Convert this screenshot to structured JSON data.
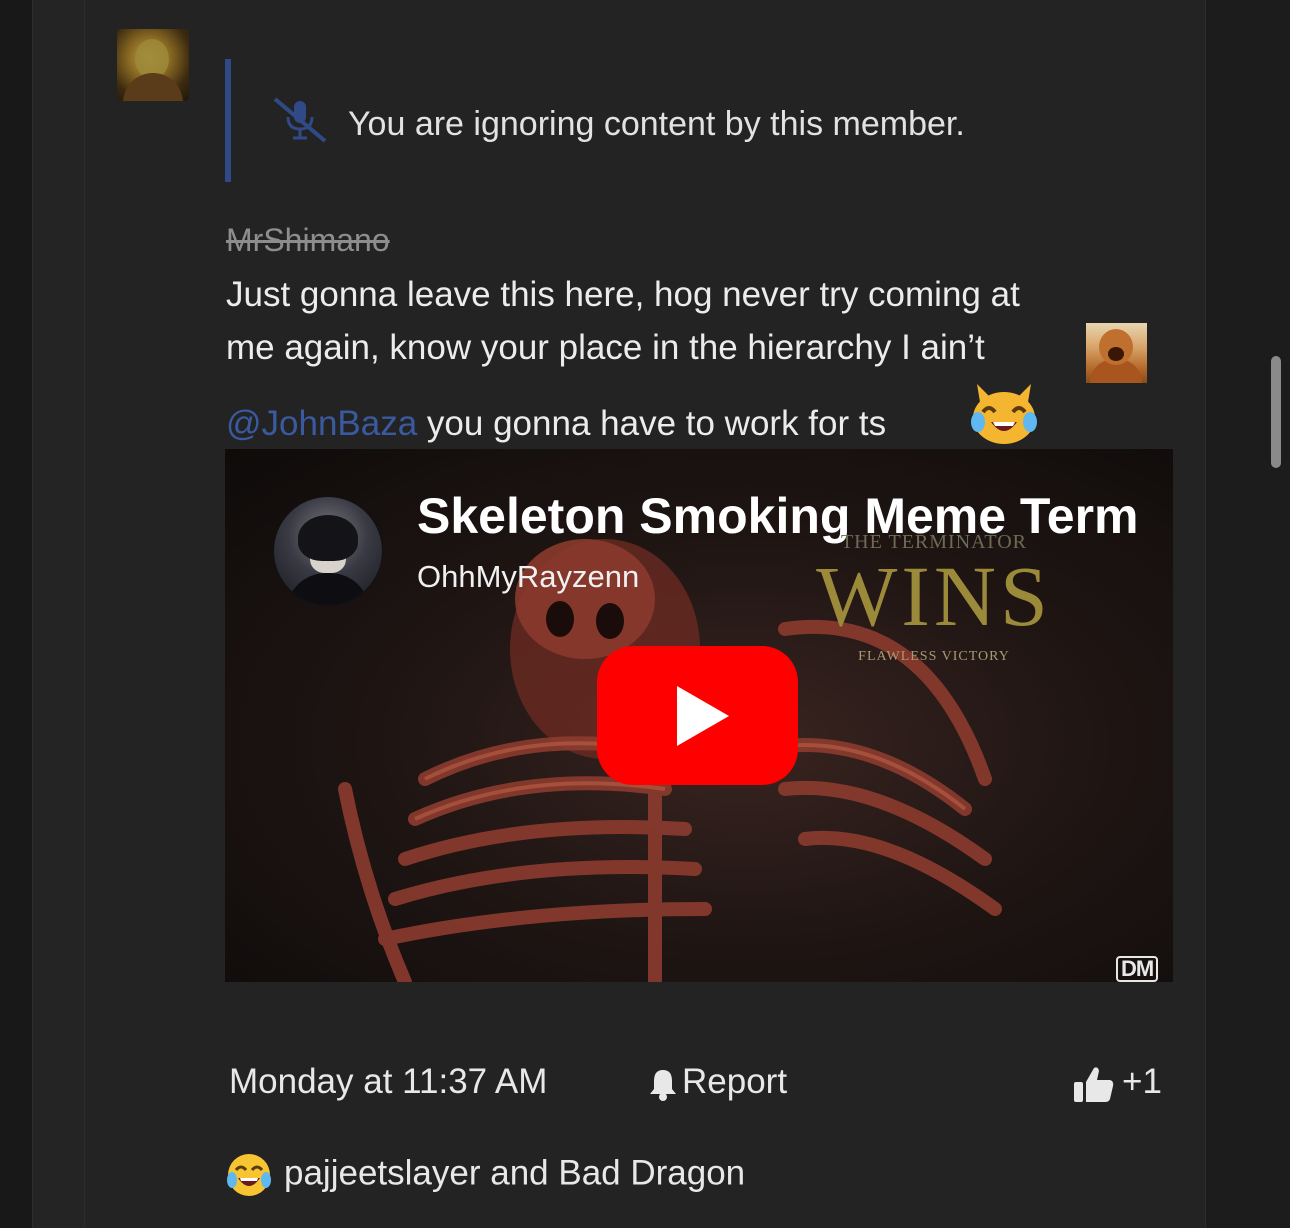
{
  "quote": {
    "ignore_text": "You are ignoring content by this member."
  },
  "post": {
    "author": "MrShimano",
    "line1": "Just gonna leave this here, hog never try coming at",
    "line2": "me again, know your place in the hierarchy I ain’t",
    "mention": "@JohnBaza",
    "line3_rest": " you gonna have to work for ts",
    "icons": [
      "orangutan-emoji",
      "laughing-cat-emoji"
    ]
  },
  "video": {
    "title": "Skeleton Smoking Meme Terminator",
    "channel": "OhhMyRayzenn",
    "overlay_top": "THE TERMINATOR",
    "overlay_big": "WINS",
    "overlay_sub": "FLAWLESS VICTORY",
    "watermark": "DM"
  },
  "footer": {
    "timestamp": "Monday at 11:37 AM",
    "report_label": "Report",
    "like_count": "+1"
  },
  "reactions": {
    "text": "pajjeetslayer and Bad Dragon",
    "icon": "crying-laughing-emoji"
  },
  "colors": {
    "mention": "#3a5aa0",
    "quote_border": "#2f4a86",
    "play_button": "#ff0000",
    "background": "#232323"
  }
}
